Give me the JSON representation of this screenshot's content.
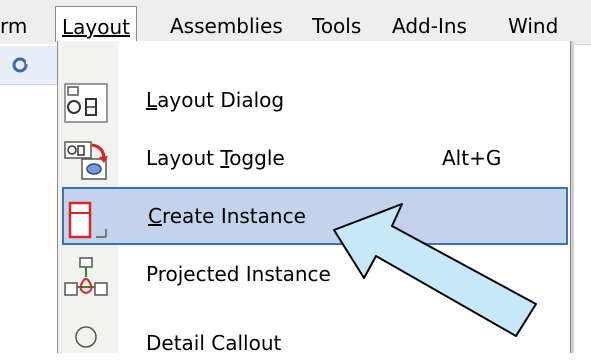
{
  "menubar": {
    "items": [
      {
        "label": "rm",
        "active": false
      },
      {
        "label": "Layout",
        "active": true
      },
      {
        "label": "Assemblies",
        "active": false
      },
      {
        "label": "Tools",
        "active": false
      },
      {
        "label": "Add-Ins",
        "active": false
      },
      {
        "label": "Wind",
        "active": false
      }
    ]
  },
  "menu": {
    "items": [
      {
        "label": "Layout Dialog",
        "shortcut": ""
      },
      {
        "label": "Layout Toggle",
        "shortcut": "Alt+G"
      },
      {
        "label": "Create Instance",
        "shortcut": "",
        "highlighted": true
      },
      {
        "label": "Projected Instance",
        "shortcut": ""
      },
      {
        "label": "Detail Callout",
        "shortcut": ""
      }
    ]
  },
  "colors": {
    "highlight_bg": "#c3d3ec",
    "highlight_border": "#3a6fc0",
    "arrow_fill": "#c7e8f8"
  }
}
